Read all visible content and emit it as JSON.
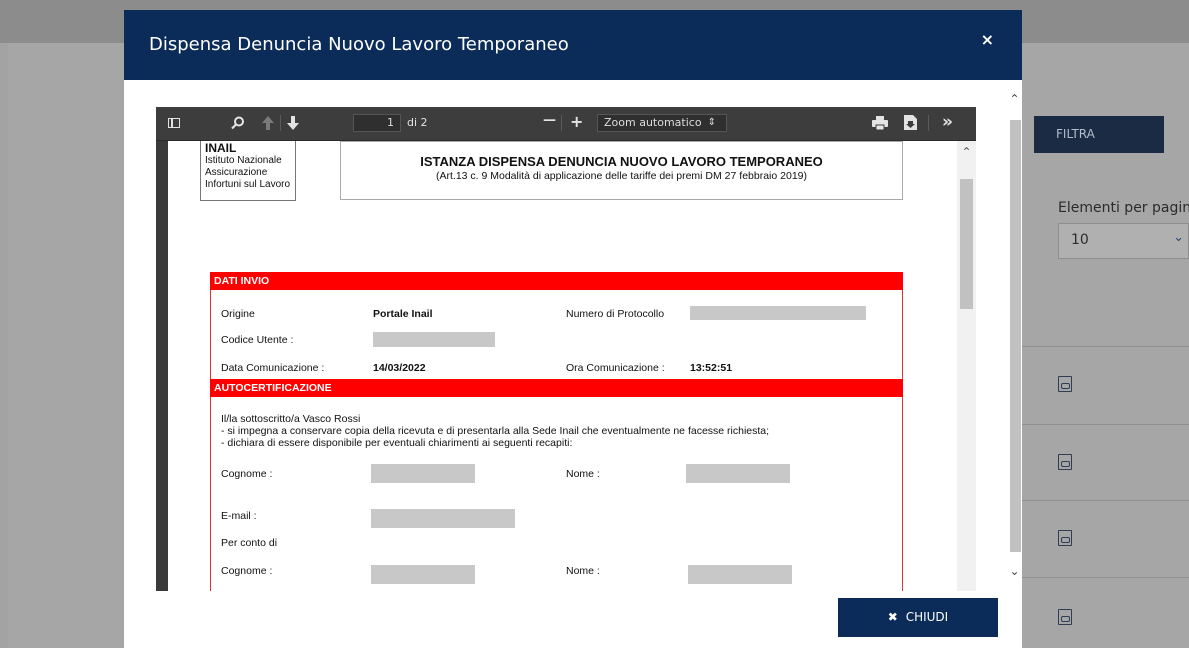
{
  "background": {
    "filter_button_label": "FILTRA",
    "elements_per_page_label": "Elementi per pagina",
    "elements_per_page_value": "10",
    "row_count": 4
  },
  "modal": {
    "title": "Dispensa Denuncia Nuovo Lavoro Temporaneo",
    "close_symbol": "×",
    "close_button_label": "CHIUDI",
    "close_button_icon": "✖"
  },
  "pdf_toolbar": {
    "page_current": "1",
    "page_total": "di 2",
    "zoom_minus": "—",
    "zoom_plus": "+",
    "zoom_value": "Zoom automatico",
    "more": "»"
  },
  "document": {
    "logo": {
      "name": "INAIL",
      "line1": "Istituto Nazionale",
      "line2": "Assicurazione",
      "line3": "Infortuni sul Lavoro"
    },
    "title": "ISTANZA DISPENSA DENUNCIA NUOVO LAVORO TEMPORANEO",
    "subtitle": "(Art.13 c. 9 Modalità di applicazione delle tariffe dei premi DM 27 febbraio 2019)",
    "dati_invio": {
      "heading": "DATI INVIO",
      "origine_label": "Origine",
      "origine_value": "Portale Inail",
      "protocollo_label": "Numero di Protocollo",
      "codice_label": "Codice Utente :",
      "data_label": "Data Comunicazione :",
      "data_value": "14/03/2022",
      "ora_label": "Ora Comunicazione :",
      "ora_value": "13:52:51"
    },
    "autocert": {
      "heading": "AUTOCERTIFICAZIONE",
      "line1": "Il/la sottoscritto/a Vasco Rossi",
      "line2": "- si impegna a conservare copia della ricevuta e di presentarla alla Sede Inail che eventualmente ne facesse richiesta;",
      "line3": "- dichiara di essere disponibile per eventuali chiarimenti ai seguenti recapiti:",
      "cognome_label": "Cognome :",
      "nome_label": "Nome :",
      "email_label": "E-mail :",
      "per_conto_label": "Per conto di",
      "cognome2_label": "Cognome :",
      "nome2_label": "Nome :"
    }
  },
  "colors": {
    "header_blue": "#0b2c59",
    "section_red": "#ff0000"
  }
}
